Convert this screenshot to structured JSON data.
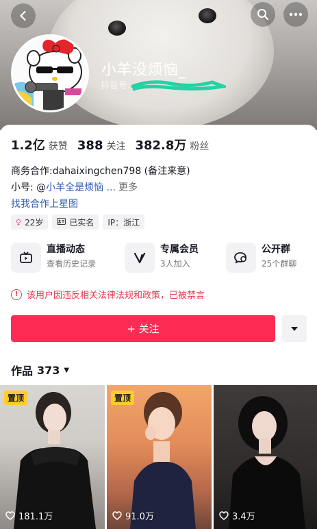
{
  "profile": {
    "nickname": "小羊没烦恼_",
    "douyin_id_label": "抖音号:",
    "avatar": "hello-kitty-avatar"
  },
  "header": {
    "back_icon": "back-arrow-icon",
    "search_icon": "search-icon",
    "more_icon": "more-dots-icon"
  },
  "stats": [
    {
      "num": "1.2亿",
      "label": "获赞"
    },
    {
      "num": "388",
      "label": "关注"
    },
    {
      "num": "382.8万",
      "label": "粉丝"
    }
  ],
  "bio": {
    "line1": "商务合作:dahaixingchen798 (备注来意)",
    "line2_prefix": "小号: @",
    "line2_link": "小羊全是烦恼 ...",
    "line2_more": "更多",
    "line3": "找我合作上星图"
  },
  "tags": [
    {
      "icon": "female-icon",
      "text": "22岁"
    },
    {
      "icon": "id-card-icon",
      "text": "已实名"
    },
    {
      "icon": "",
      "text": "IP：浙江"
    }
  ],
  "features": [
    {
      "icon": "live-tv-icon",
      "title": "直播动态",
      "sub": "查看历史记录"
    },
    {
      "icon": "vip-icon",
      "title": "专属会员",
      "sub": "3人加入"
    },
    {
      "icon": "chat-group-icon",
      "title": "公开群",
      "sub": "25个群聊"
    }
  ],
  "warning": "该用户因违反相关法律法规和政策，已被禁言",
  "actions": {
    "follow": "+ 关注"
  },
  "works": {
    "title": "作品",
    "count": "373",
    "items": [
      {
        "pinned": "置顶",
        "likes": "181.1万"
      },
      {
        "pinned": "置顶",
        "likes": "91.0万"
      },
      {
        "pinned": "",
        "likes": "3.4万"
      }
    ]
  },
  "colors": {
    "accent": "#fe2c55",
    "warning": "#e8384f",
    "link": "#2b5aa8",
    "pin": "#ffcd2b"
  }
}
